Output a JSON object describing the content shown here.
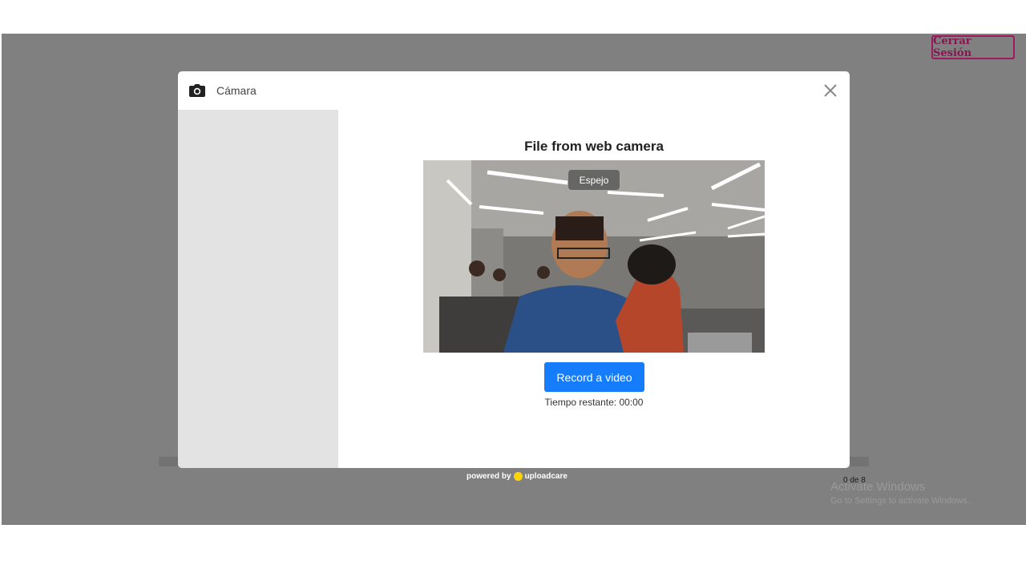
{
  "header": {
    "logout_label": "Cerrar Sesión"
  },
  "modal": {
    "title": "Cámara",
    "content_title": "File from web camera",
    "mirror_label": "Espejo",
    "record_label": "Record a video",
    "timer_text": "Tiempo restante: 00:00"
  },
  "footer": {
    "powered_prefix": "powered by",
    "powered_brand": "uploadcare",
    "counter": "0 de 8"
  },
  "watermark": {
    "title": "Activate Windows",
    "subtitle": "Go to Settings to activate Windows."
  },
  "colors": {
    "accent": "#157cfc",
    "logout_border": "#a0195f",
    "brand_dot": "#ffd400"
  },
  "icons": {
    "camera": "camera-icon",
    "close": "close-icon"
  }
}
